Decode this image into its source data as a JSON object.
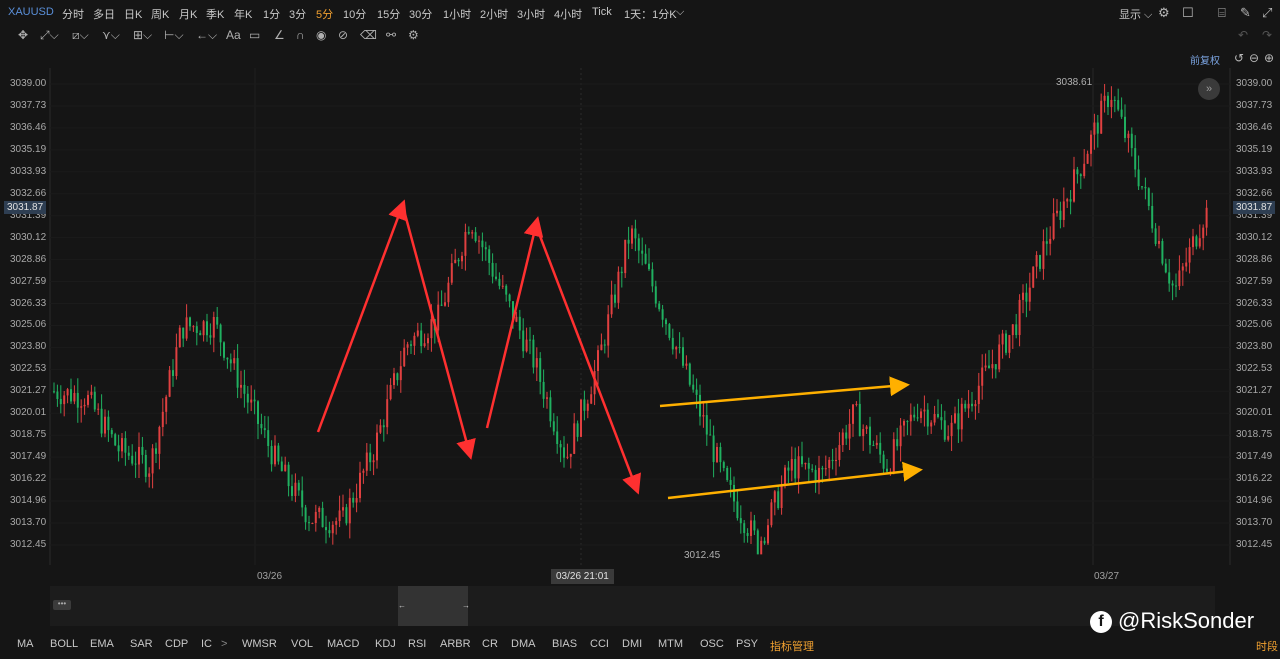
{
  "symbol": "XAUUSD",
  "timeframes": [
    {
      "label": "分时"
    },
    {
      "label": "多日"
    },
    {
      "label": "日K"
    },
    {
      "label": "周K"
    },
    {
      "label": "月K"
    },
    {
      "label": "季K"
    },
    {
      "label": "年K"
    },
    {
      "label": "1分"
    },
    {
      "label": "3分"
    },
    {
      "label": "5分",
      "active": true
    },
    {
      "label": "10分"
    },
    {
      "label": "15分"
    },
    {
      "label": "30分"
    },
    {
      "label": "1小时"
    },
    {
      "label": "2小时"
    },
    {
      "label": "3小时"
    },
    {
      "label": "4小时"
    },
    {
      "label": "Tick"
    },
    {
      "label": "1天：1分K"
    }
  ],
  "top_right": {
    "display_label": "显示"
  },
  "restore_label": "前复权",
  "y_axis_labels": [
    "3039.00",
    "3037.73",
    "3036.46",
    "3035.19",
    "3033.93",
    "3032.66",
    "3031.39",
    "3030.12",
    "3028.86",
    "3027.59",
    "3026.33",
    "3025.06",
    "3023.80",
    "3022.53",
    "3021.27",
    "3020.01",
    "3018.75",
    "3017.49",
    "3016.22",
    "3014.96",
    "3013.70",
    "3012.45"
  ],
  "current_price": "3031.87",
  "high_annotation": "3038.61",
  "low_annotation": "3012.45",
  "x_labels": {
    "d1": "03/26",
    "cursor": "03/26 21:01",
    "d2": "03/27"
  },
  "indicators": [
    "MA",
    "BOLL",
    "EMA",
    "SAR",
    "CDP",
    "IC",
    "WMSR",
    "VOL",
    "MACD",
    "KDJ",
    "RSI",
    "ARBR",
    "CR",
    "DMA",
    "BIAS",
    "CCI",
    "DMI",
    "MTM",
    "OSC",
    "PSY"
  ],
  "indicator_manage": "指标管理",
  "period_label": "时段",
  "watermark": "@RiskSonder",
  "watermark_icon": "f",
  "colors": {
    "up": "#e04040",
    "down": "#20b060",
    "arrow_red": "#ff3030",
    "arrow_yellow": "#ffb000",
    "accent": "#f0a030"
  },
  "chart_data": {
    "type": "candlestick",
    "symbol": "XAUUSD",
    "interval": "5分",
    "ylim": [
      3012.45,
      3039.0
    ],
    "close_path": [
      {
        "x": "03/25 start",
        "y": 3021.3
      },
      {
        "x": "03/25",
        "y": 3021.0
      },
      {
        "x": "03/25",
        "y": 3018.0
      },
      {
        "x": "03/25",
        "y": 3017.0
      },
      {
        "x": "03/25",
        "y": 3025.0
      },
      {
        "x": "03/25",
        "y": 3025.2
      },
      {
        "x": "03/25",
        "y": 3021.0
      },
      {
        "x": "03/25",
        "y": 3017.0
      },
      {
        "x": "03/26",
        "y": 3014.0
      },
      {
        "x": "03/26",
        "y": 3013.8
      },
      {
        "x": "03/26",
        "y": 3018.0
      },
      {
        "x": "03/26",
        "y": 3024.0
      },
      {
        "x": "03/26",
        "y": 3025.5
      },
      {
        "x": "03/26",
        "y": 3031.3
      },
      {
        "x": "03/26",
        "y": 3027.0
      },
      {
        "x": "03/26",
        "y": 3023.0
      },
      {
        "x": "03/26",
        "y": 3017.5
      },
      {
        "x": "03/26",
        "y": 3023.0
      },
      {
        "x": "03/26",
        "y": 3030.5
      },
      {
        "x": "03/26",
        "y": 3026.0
      },
      {
        "x": "03/26 21:01",
        "y": 3021.0
      },
      {
        "x": "03/26",
        "y": 3015.8
      },
      {
        "x": "03/26",
        "y": 3012.45
      },
      {
        "x": "03/26",
        "y": 3017.0
      },
      {
        "x": "03/26",
        "y": 3016.5
      },
      {
        "x": "03/26",
        "y": 3020.0
      },
      {
        "x": "03/26",
        "y": 3017.0
      },
      {
        "x": "03/26",
        "y": 3020.5
      },
      {
        "x": "03/26",
        "y": 3019.0
      },
      {
        "x": "03/26",
        "y": 3022.0
      },
      {
        "x": "03/27",
        "y": 3025.0
      },
      {
        "x": "03/27",
        "y": 3030.0
      },
      {
        "x": "03/27",
        "y": 3034.0
      },
      {
        "x": "03/27",
        "y": 3038.61
      },
      {
        "x": "03/27",
        "y": 3033.0
      },
      {
        "x": "03/27",
        "y": 3027.0
      },
      {
        "x": "03/27 end",
        "y": 3031.87
      }
    ],
    "high": 3038.61,
    "low": 3012.45,
    "last": 3031.87
  }
}
